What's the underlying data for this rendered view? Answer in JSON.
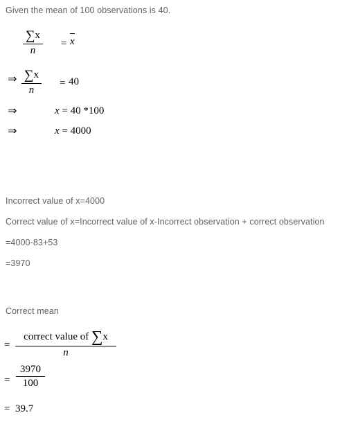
{
  "document": {
    "intro": "Given the mean of 100 observations is 40.",
    "equations": {
      "eq1": {
        "numerator_sigma": "∑",
        "numerator_var": "x",
        "denominator": "n",
        "equals": "=",
        "rhs_var": "x",
        "rhs_is_mean_bar": true
      },
      "eq2": {
        "arrow": "⇒",
        "numerator_sigma": "∑",
        "numerator_var": "x",
        "denominator": "n",
        "equals": "=",
        "rhs": "40"
      },
      "eq3": {
        "arrow": "⇒",
        "lhs": "x",
        "relation": "= 40 *100"
      },
      "eq4": {
        "arrow": "⇒",
        "lhs": "x",
        "relation": "= 4000"
      }
    },
    "statements": [
      "Incorrect value of x=4000",
      "Correct value of x=Incorrect value of x-Incorrect observation + correct observation",
      "=4000-83+53",
      "=3970"
    ],
    "correct_mean_heading": "Correct mean",
    "correct_mean": {
      "equals_1": "=",
      "numerator_text": "correct value of",
      "numerator_sigma": "∑",
      "numerator_var": "x",
      "denominator": "n",
      "equals_2": "=",
      "value_numerator": "3970",
      "value_denominator": "100",
      "equals_3": "=",
      "final_value": "39.7"
    }
  },
  "colors": {
    "background": "#ffffff",
    "prose_text": "#5a6268",
    "math_text": "#000000"
  }
}
